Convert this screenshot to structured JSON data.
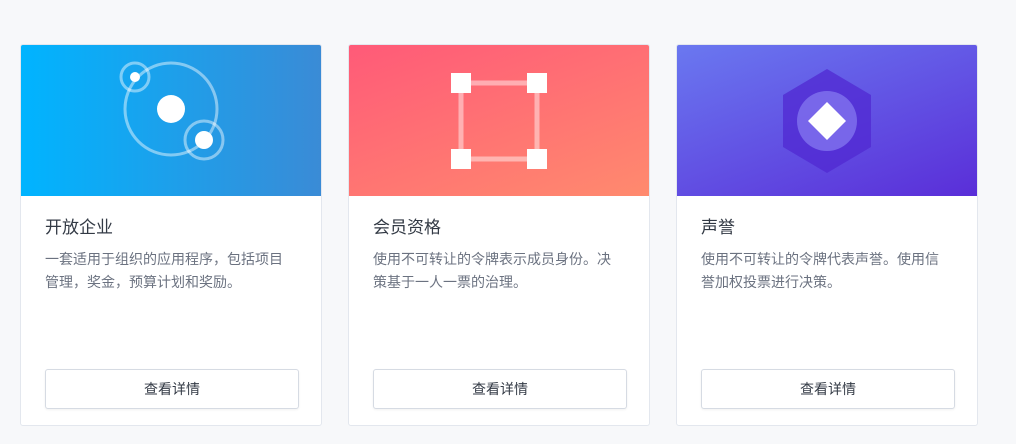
{
  "cards": [
    {
      "title": "开放企业",
      "description": "一套适用于组织的应用程序，包括项目管理，奖金，预算计划和奖励。",
      "button_label": "查看详情",
      "icon": "orbit-icon",
      "gradient": [
        "#00b4ff",
        "#3a8bd6"
      ]
    },
    {
      "title": "会员资格",
      "description": "使用不可转让的令牌表示成员身份。决策基于一人一票的治理。",
      "button_label": "查看详情",
      "icon": "square-nodes-icon",
      "gradient": [
        "#ff5a78",
        "#ff8a6e"
      ]
    },
    {
      "title": "声誉",
      "description": "使用不可转让的令牌代表声誉。使用信誉加权投票进行决策。",
      "button_label": "查看详情",
      "icon": "hexagon-diamond-icon",
      "gradient": [
        "#6a78f0",
        "#5a2ed8"
      ]
    }
  ]
}
